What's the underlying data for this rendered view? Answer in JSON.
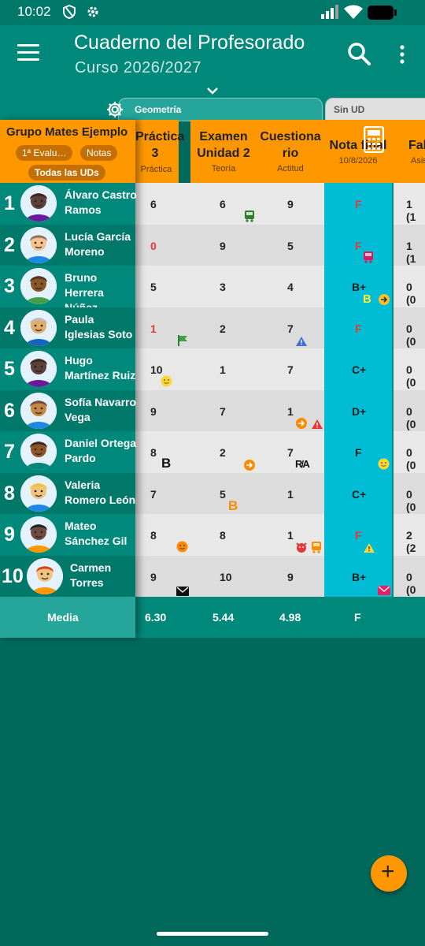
{
  "status_bar": {
    "time": "10:02"
  },
  "app_bar": {
    "title": "Cuaderno del Profesorado",
    "subtitle": "Curso 2026/2027"
  },
  "tabs": [
    {
      "label": "Geometría"
    },
    {
      "label": "Sin UD"
    }
  ],
  "group": {
    "name": "Grupo Mates Ejemplo",
    "evaluation": "1ª Evalu…",
    "notes": "Notas",
    "all_units": "Todas las UDs"
  },
  "columns": [
    {
      "title": "Práctica 3",
      "subtitle": "Práctica"
    },
    {
      "title": "Examen Unidad 2",
      "subtitle": "Teoría"
    },
    {
      "title": "Cuestiona rio",
      "subtitle": "Actitud"
    },
    {
      "title": "Nota final",
      "subtitle": "10/8/2026"
    },
    {
      "title": "Fal",
      "subtitle": "Asist"
    }
  ],
  "students": [
    {
      "num": "1",
      "name": "Álvaro Castro Ramos",
      "grades": [
        "6",
        "6",
        "9"
      ],
      "final": "F",
      "absences": "1 (1"
    },
    {
      "num": "2",
      "name": "Lucía García Moreno",
      "grades": [
        "0",
        "9",
        "5"
      ],
      "final": "F",
      "absences": "1 (1"
    },
    {
      "num": "3",
      "name": "Bruno Herrera Núñez",
      "grades": [
        "5",
        "3",
        "4"
      ],
      "final": "B+",
      "absences": "0 (0"
    },
    {
      "num": "4",
      "name": "Paula Iglesias Soto",
      "grades": [
        "1",
        "2",
        "7"
      ],
      "final": "F",
      "absences": "0 (0"
    },
    {
      "num": "5",
      "name": "Hugo Martínez Ruiz",
      "grades": [
        "10",
        "1",
        "7"
      ],
      "final": "C+",
      "absences": "0 (0"
    },
    {
      "num": "6",
      "name": "Sofía Navarro Vega",
      "grades": [
        "9",
        "7",
        "1"
      ],
      "final": "D+",
      "absences": "0 (0"
    },
    {
      "num": "7",
      "name": "Daniel Ortega Pardo",
      "grades": [
        "8",
        "2",
        "7"
      ],
      "final": "F",
      "absences": "0 (0"
    },
    {
      "num": "8",
      "name": "Valeria Romero León",
      "grades": [
        "7",
        "5",
        "1"
      ],
      "final": "C+",
      "absences": "0 (0"
    },
    {
      "num": "9",
      "name": "Mateo Sánchez Gil",
      "grades": [
        "8",
        "8",
        "1"
      ],
      "final": "F",
      "absences": "2 (2"
    },
    {
      "num": "10",
      "name": "Carmen Torres",
      "grades": [
        "9",
        "10",
        "9"
      ],
      "final": "B+",
      "absences": "0 (0"
    }
  ],
  "media": {
    "label": "Media",
    "values": [
      "6.30",
      "5.44",
      "4.98",
      "F"
    ]
  },
  "cell_markers": {
    "b_letter": "B",
    "ra_letters": "R̸A",
    "r1_c2": "bus-icon",
    "r2_final": "bus-icon",
    "r3_final": "B arrow-icon",
    "r4_c1": "flag-icon",
    "r4_c3": "warning-icon",
    "r5_c1": "smiley-icon",
    "r6_c3": "arrow-warning-icon",
    "r7_c1": "B",
    "r7_c2": "arrow-icon",
    "r7_c3": "R̸A",
    "r7_final": "smiley-icon",
    "r8_c2": "B",
    "r9_c1": "smiley-icon",
    "r9_c3": "devil-bus-icon",
    "r9_final": "warning-icon",
    "r10_c1": "mail-icon",
    "r10_final": "mail-icon"
  },
  "colors": {
    "primary": "#00897b",
    "primary_dark": "#00695c",
    "accent": "#ff9800",
    "final_column": "#00bcd4",
    "fail_red": "#e53935"
  }
}
